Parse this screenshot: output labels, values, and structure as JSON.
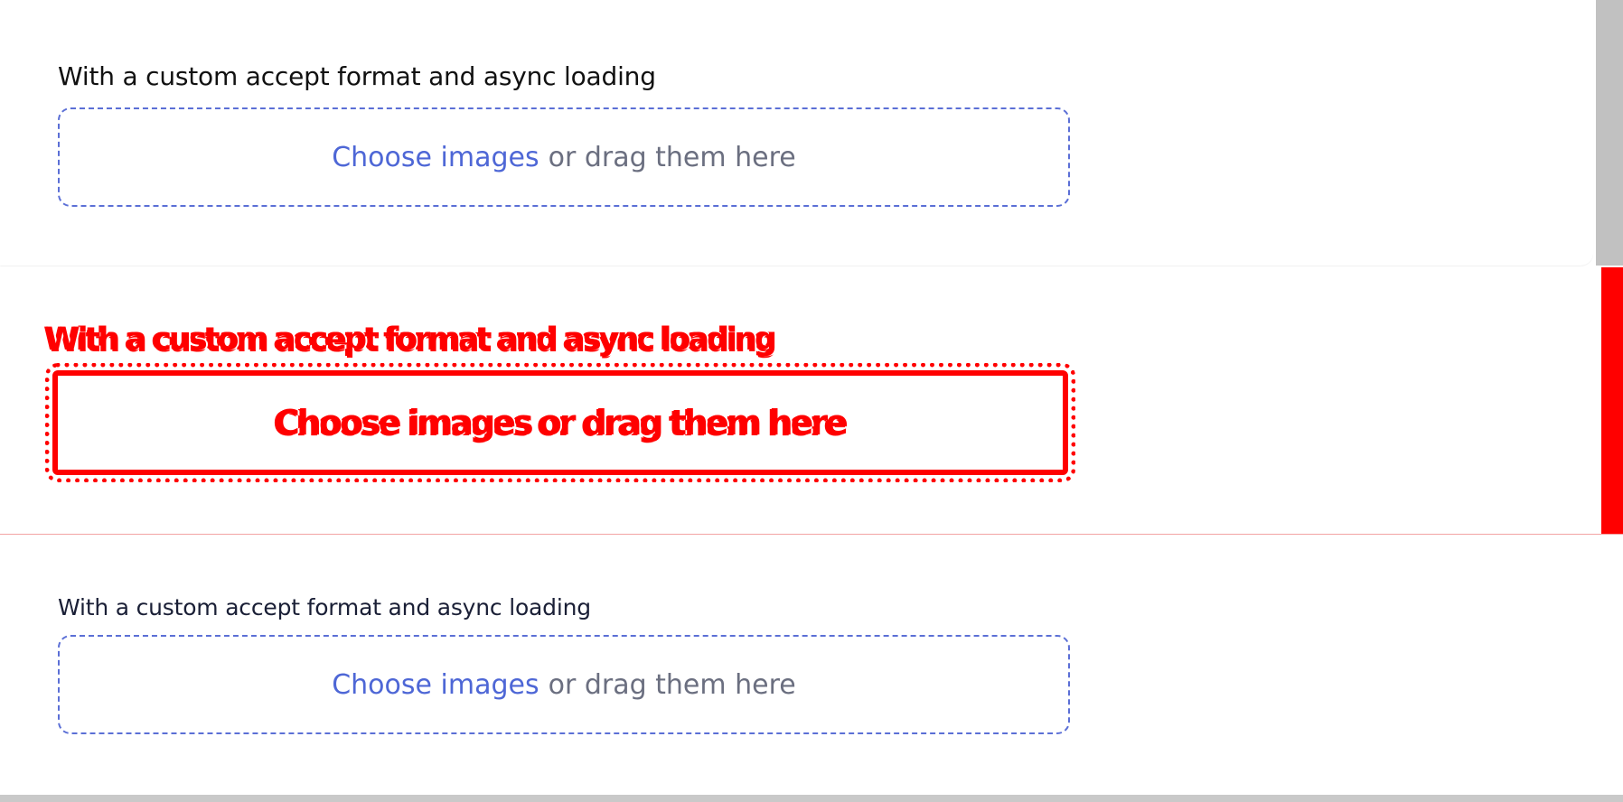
{
  "sections": [
    {
      "label": "With a custom accept format and async loading",
      "dropzone": {
        "link_text": "Choose images",
        "rest_text": "or drag them here"
      }
    },
    {
      "label": "With a custom accept format and async loading",
      "dropzone": {
        "link_text": "Choose images",
        "rest_text": "or drag them here"
      }
    },
    {
      "label": "With a custom accept format and async loading",
      "dropzone": {
        "link_text": "Choose images",
        "rest_text": "or drag them here"
      }
    }
  ],
  "colors": {
    "link": "#4e67d6",
    "muted_text": "#6b6f80",
    "dropzone_border": "#5b6fd6",
    "diff_highlight": "#ff0000",
    "scrollbar": "#c1c1c1"
  }
}
